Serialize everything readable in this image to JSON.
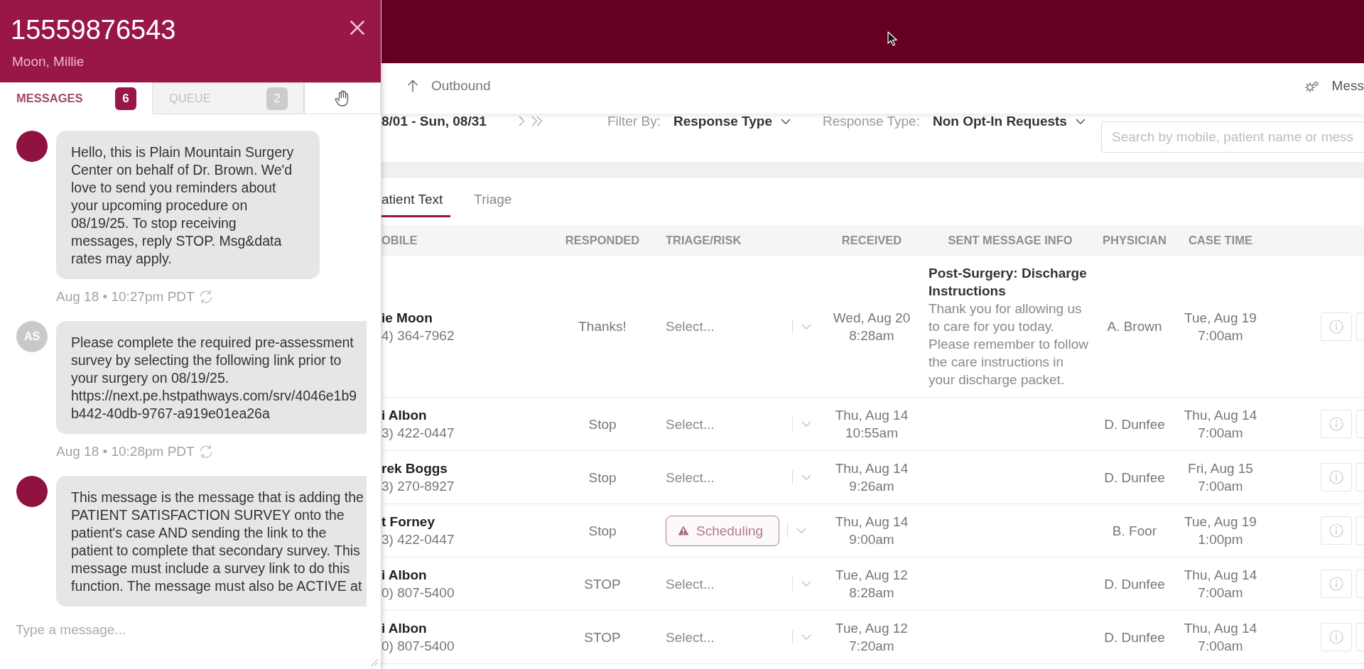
{
  "chat_panel": {
    "phone": "15559876543",
    "name": "Moon, Millie",
    "tabs": [
      {
        "kind": "text",
        "label": "MESSAGES",
        "count": "6",
        "selected": true
      },
      {
        "kind": "text",
        "label": "QUEUE",
        "count": "2",
        "selected": false
      },
      {
        "kind": "icon",
        "selected": false
      }
    ],
    "messages": [
      {
        "kind": "automated",
        "text": "Hello, this is Plain Mountain Surgery Center on behalf of Dr. Brown. We'd love to send you reminders about your upcoming procedure on 08/19/25. To stop receiving messages, reply STOP. Msg&data rates may apply.",
        "timestamp": "Aug 18 • 10:27pm PDT"
      },
      {
        "kind": "staff",
        "initials": "AS",
        "text": "Please complete the required pre-assessment survey by selecting the following link prior to your surgery on 08/19/25. https://next.pe.hstpathways.com/srv/4046e1b9 b442-40db-9767-a919e01ea26a",
        "timestamp": "Aug 18 • 10:28pm PDT"
      },
      {
        "kind": "automated",
        "text": "This message is the message that is adding the PATIENT SATISFACTION SURVEY onto the patient's case AND sending the link to the patient to complete that secondary survey. This message must include a survey link to do this function. The message must also be ACTIVE at"
      }
    ],
    "composer": {
      "placeholder": "Type a message..."
    }
  },
  "nav": {
    "outbound": "Outbound",
    "menu_label": "Mess"
  },
  "toolbar": {
    "date_range": "8/01 - Sun, 08/31",
    "filters": [
      {
        "label": "Filter By:",
        "value": "Response Type"
      },
      {
        "label": "Response Type:",
        "value": "Non Opt-In Requests"
      }
    ],
    "search": {
      "placeholder": "Search by mobile, patient name or mess"
    }
  },
  "view_tabs": [
    {
      "label": "atient Text",
      "selected": true
    },
    {
      "label": "Triage",
      "selected": false
    }
  ],
  "table": {
    "columns": [
      "OBILE",
      "RESPONDED",
      "TRIAGE/RISK",
      "RECEIVED",
      "SENT MESSAGE INFO",
      "PHYSICIAN",
      "CASE TIME"
    ],
    "rows": [
      {
        "name": "ie Moon",
        "mobile": "4) 364-7962",
        "responded": "Thanks!",
        "triage": {
          "kind": "select",
          "text": "Select..."
        },
        "received": {
          "date": "Wed, Aug 20",
          "time": "8:28am"
        },
        "sent_message": {
          "title": "Post-Surgery: Discharge Instructions",
          "body": "Thank you for allowing us to care for you today. Please remember to follow the care instructions in your discharge packet."
        },
        "physician": "A. Brown",
        "case_time": {
          "date": "Tue, Aug 19",
          "time": "7:00am"
        }
      },
      {
        "name": "i Albon",
        "mobile": "3) 422-0447",
        "responded": "Stop",
        "triage": {
          "kind": "select",
          "text": "Select..."
        },
        "received": {
          "date": "Thu, Aug 14",
          "time": "10:55am"
        },
        "physician": "D. Dunfee",
        "case_time": {
          "date": "Thu, Aug 14",
          "time": "7:00am"
        }
      },
      {
        "name": "rek Boggs",
        "mobile": "3) 270-8927",
        "responded": "Stop",
        "triage": {
          "kind": "select",
          "text": "Select..."
        },
        "received": {
          "date": "Thu, Aug 14",
          "time": "9:26am"
        },
        "physician": "D. Dunfee",
        "case_time": {
          "date": "Fri, Aug 15",
          "time": "7:00am"
        }
      },
      {
        "name": "t Forney",
        "mobile": "3) 422-0447",
        "responded": "Stop",
        "triage": {
          "kind": "tag",
          "text": "Scheduling"
        },
        "received": {
          "date": "Thu, Aug 14",
          "time": "9:00am"
        },
        "physician": "B. Foor",
        "case_time": {
          "date": "Tue, Aug 19",
          "time": "1:00pm"
        }
      },
      {
        "name": "i Albon",
        "mobile": "0) 807-5400",
        "responded": "STOP",
        "triage": {
          "kind": "select",
          "text": "Select..."
        },
        "received": {
          "date": "Tue, Aug 12",
          "time": "8:28am"
        },
        "physician": "D. Dunfee",
        "case_time": {
          "date": "Thu, Aug 14",
          "time": "7:00am"
        }
      },
      {
        "name": "i Albon",
        "mobile": "0) 807-5400",
        "responded": "STOP",
        "triage": {
          "kind": "select",
          "text": "Select..."
        },
        "received": {
          "date": "Tue, Aug 12",
          "time": "7:20am"
        },
        "physician": "D. Dunfee",
        "case_time": {
          "date": "Thu, Aug 14",
          "time": "7:00am"
        }
      }
    ]
  }
}
